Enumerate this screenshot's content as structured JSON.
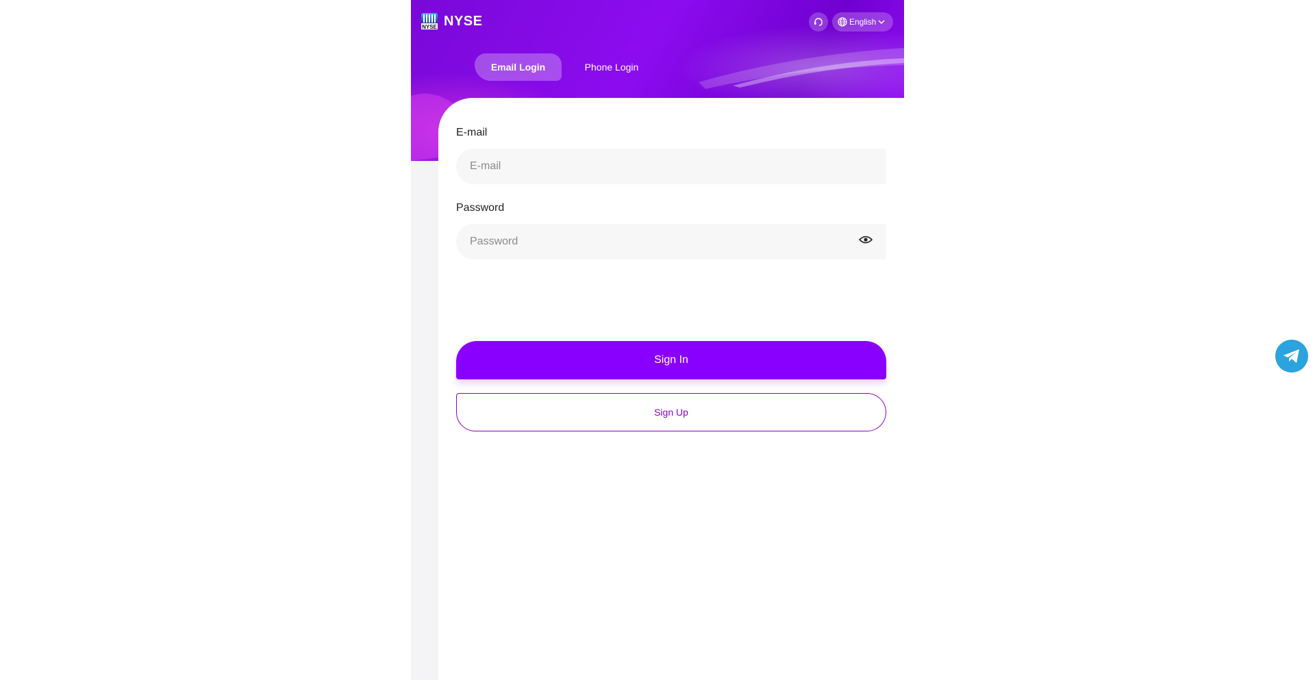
{
  "header": {
    "brand": "NYSE",
    "logo_text": "NYSE",
    "support_icon": "headset-icon",
    "language_icon": "globe-icon",
    "language": "English"
  },
  "tabs": [
    {
      "label": "Email Login",
      "active": true
    },
    {
      "label": "Phone Login",
      "active": false
    }
  ],
  "form": {
    "email_label": "E-mail",
    "email_placeholder": "E-mail",
    "email_value": "",
    "password_label": "Password",
    "password_placeholder": "Password",
    "password_value": "",
    "signin_label": "Sign In",
    "signup_label": "Sign Up"
  },
  "floating": {
    "icon": "telegram-icon"
  },
  "colors": {
    "primary": "#8a00ff",
    "signup_border": "#8a00c8",
    "telegram": "#2aa3df"
  }
}
